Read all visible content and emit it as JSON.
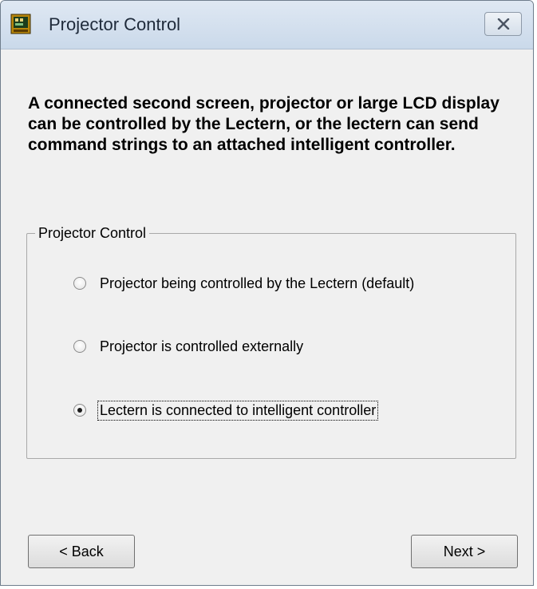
{
  "window": {
    "title": "Projector Control",
    "app_icon": "projector-control-app-icon",
    "close_icon": "close-icon"
  },
  "description": "A connected second screen, projector or large LCD display can be controlled by the Lectern, or the lectern can send command strings to an attached intelligent controller.",
  "group": {
    "label": "Projector Control",
    "options": [
      {
        "label": "Projector being controlled by the Lectern (default)",
        "selected": false
      },
      {
        "label": "Projector is controlled externally",
        "selected": false
      },
      {
        "label": "Lectern is connected to intelligent controller",
        "selected": true
      }
    ]
  },
  "buttons": {
    "back_label": "< Back",
    "next_label": "Next >"
  }
}
